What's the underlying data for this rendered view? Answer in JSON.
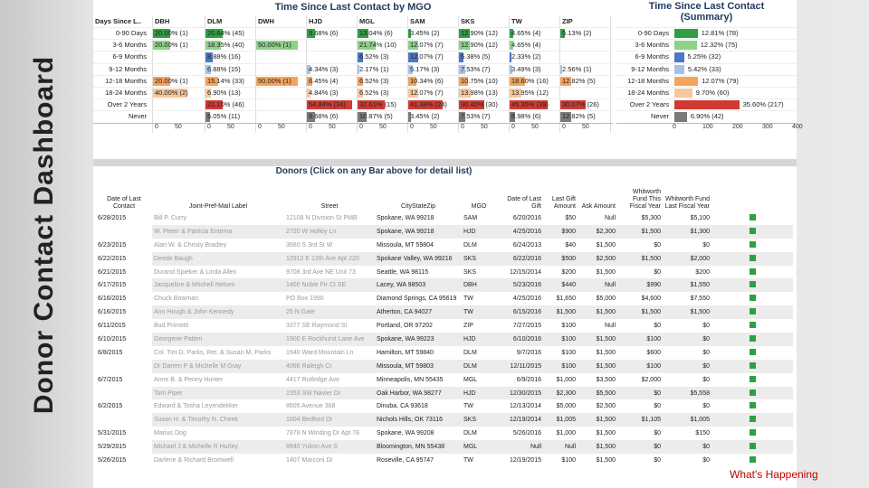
{
  "page_title": "Donor Contact Dashboard",
  "footer_note": "What's Happening",
  "chart_data": [
    {
      "type": "heatmap",
      "title": "Time Since Last Contact by MGO",
      "row_header": "Days Since L..",
      "columns": [
        "DBH",
        "DLM",
        "DWH",
        "HJD",
        "MGL",
        "SAM",
        "SKS",
        "TW",
        "ZIP"
      ],
      "rows": [
        "0-90 Days",
        "3-6 Months",
        "6-9 Months",
        "9-12 Months",
        "12-18 Months",
        "18-24 Months",
        "Over 2 Years",
        "Never"
      ],
      "row_colors": [
        "#2ea043",
        "#8fd18a",
        "#4a78c4",
        "#a9c0e6",
        "#f5a35b",
        "#f6c79b",
        "#d03a33",
        "#7a7a7a"
      ],
      "cells": [
        [
          "20.00% (1)",
          "20.64% (45)",
          "",
          "9.68% (6)",
          "13.04% (6)",
          "3.45% (2)",
          "12.90% (12)",
          "4.65% (4)",
          "5.13% (2)"
        ],
        [
          "20.00% (1)",
          "18.35% (40)",
          "50.00% (1)",
          "",
          "21.74% (10)",
          "12.07% (7)",
          "12.90% (12)",
          "4.65% (4)",
          ""
        ],
        [
          "",
          "8.88% (16)",
          "",
          "",
          "6.52% (3)",
          "12.07% (7)",
          "5.38% (5)",
          "2.33% (2)",
          ""
        ],
        [
          "",
          "6.88% (15)",
          "",
          "4.34% (3)",
          "2.17% (1)",
          "5.17% (3)",
          "7.53% (7)",
          "3.49% (3)",
          "2.56% (1)"
        ],
        [
          "20.00% (1)",
          "15.14% (33)",
          "50.00% (1)",
          "6.45% (4)",
          "6.52% (3)",
          "10.34% (6)",
          "10.75% (10)",
          "18.60% (16)",
          "12.82% (5)"
        ],
        [
          "40.00% (2)",
          "6.90% (13)",
          "",
          "4.84% (3)",
          "6.52% (3)",
          "12.07% (7)",
          "13.98% (13)",
          "13.95% (12)",
          ""
        ],
        [
          "",
          "21.10% (46)",
          "",
          "54.84% (34)",
          "32.61% (15)",
          "41.38% (24)",
          "30.40% (30)",
          "45.35% (39)",
          "30.07% (26)"
        ],
        [
          "",
          "5.05% (11)",
          "",
          "9.68% (6)",
          "10.87% (5)",
          "3.45% (2)",
          "7.53% (7)",
          "6.98% (6)",
          "12.82% (5)"
        ]
      ],
      "bar_values": [
        [
          20.0,
          20.64,
          0,
          9.68,
          13.04,
          3.45,
          12.9,
          4.65,
          5.13
        ],
        [
          20.0,
          18.35,
          50.0,
          0,
          21.74,
          12.07,
          12.9,
          4.65,
          0
        ],
        [
          0,
          8.88,
          0,
          0,
          6.52,
          12.07,
          5.38,
          2.33,
          0
        ],
        [
          0,
          6.88,
          0,
          4.34,
          2.17,
          5.17,
          7.53,
          3.49,
          2.56
        ],
        [
          20.0,
          15.14,
          50.0,
          6.45,
          6.52,
          10.34,
          10.75,
          18.6,
          12.82
        ],
        [
          40.0,
          6.9,
          0,
          4.84,
          6.52,
          12.07,
          13.98,
          13.95,
          0
        ],
        [
          0,
          21.1,
          0,
          54.84,
          32.61,
          41.38,
          30.4,
          45.35,
          30.07
        ],
        [
          0,
          5.05,
          0,
          9.68,
          10.87,
          3.45,
          7.53,
          6.98,
          12.82
        ]
      ],
      "axis_ticks": [
        "0",
        "50"
      ]
    },
    {
      "type": "bar",
      "title": "Time Since Last Contact (Summary)",
      "title_line1": "Time Since Last Contact",
      "title_line2": "(Summary)",
      "categories": [
        "0-90 Days",
        "3-6 Months",
        "6-9 Months",
        "9-12 Months",
        "12-18 Months",
        "18-24 Months",
        "Over 2 Years",
        "Never"
      ],
      "labels": [
        "12.81% (78)",
        "12.32% (75)",
        "5.25% (32)",
        "5.42% (33)",
        "12.07% (79)",
        "9.70% (60)",
        "35.60% (217)",
        "6.90% (42)"
      ],
      "values": [
        78,
        75,
        32,
        33,
        79,
        60,
        217,
        42
      ],
      "colors": [
        "#2ea043",
        "#8fd18a",
        "#4a78c4",
        "#a9c0e6",
        "#f5a35b",
        "#f6c79b",
        "#d03a33",
        "#7a7a7a"
      ],
      "axis_ticks": [
        "0",
        "100",
        "200",
        "300",
        "400"
      ],
      "xlim": [
        0,
        400
      ]
    }
  ],
  "donors": {
    "title": "Donors (Click on any Bar above for detail list)",
    "headers": [
      "Date of Last Contact",
      "Joint-Pref-Mail Label",
      "Street",
      "CityStateZip",
      "MGO",
      "Date of Last Gift",
      "Last Gift Amount",
      "Ask Amount",
      "Whitworth Fund This Fiscal Year",
      "Whitworth Fund Last Fiscal Year",
      ""
    ],
    "rows": [
      [
        "6/28/2015",
        "Bill P. Curry",
        "12108 N Division St PMB",
        "Spokane, WA 99218",
        "SAM",
        "6/20/2016",
        "$50",
        "Null",
        "$5,300",
        "$5,100"
      ],
      [
        "",
        "W. Pieter & Patricia Entema",
        "2720 W Holley Ln",
        "Spokane, WA 99218",
        "HJD",
        "4/25/2016",
        "$900",
        "$2,300",
        "$1,500",
        "$1,300"
      ],
      [
        "6/23/2015",
        "Alan W. & Christy Bradley",
        "3660 S 3rd St W",
        "Missoula, MT 59804",
        "DLM",
        "6/24/2013",
        "$40",
        "$1,500",
        "$0",
        "$0"
      ],
      [
        "6/22/2015",
        "Deede Baugh",
        "12912 E 12th Ave Apt 220",
        "Spokane Valley, WA 99216",
        "SKS",
        "6/22/2016",
        "$500",
        "$2,500",
        "$1,500",
        "$2,000"
      ],
      [
        "6/21/2015",
        "Durand Spieker & Linda Allen",
        "9708 3rd Ave NE Unit 73",
        "Seattle, WA 98115",
        "SKS",
        "12/15/2014",
        "$200",
        "$1,500",
        "$0",
        "$200"
      ],
      [
        "6/17/2015",
        "Jacqueline & Mitchell Nelsen",
        "1400 Noble Fir Ct SE",
        "Lacey, WA 98503",
        "DBH",
        "5/23/2016",
        "$440",
        "Null",
        "$990",
        "$1,550"
      ],
      [
        "6/16/2015",
        "Chuck Bowman",
        "PO Box 1990",
        "Diamond Springs, CA 95619",
        "TW",
        "4/25/2016",
        "$1,650",
        "$5,000",
        "$4,600",
        "$7,550"
      ],
      [
        "6/16/2015",
        "Ann Hough & John Kennedy",
        "25 N Gate",
        "Atherton, CA 94027",
        "TW",
        "6/15/2016",
        "$1,500",
        "$1,500",
        "$1,500",
        "$1,500"
      ],
      [
        "6/11/2015",
        "Bud Primotti",
        "3377 SE Raymond St",
        "Portland, OR 97202",
        "ZIP",
        "7/27/2015",
        "$100",
        "Null",
        "$0",
        "$0"
      ],
      [
        "6/10/2015",
        "Georgene Patten",
        "1900 E Rockhurst Lane Ave",
        "Spokane, WA 99223",
        "HJD",
        "6/10/2016",
        "$100",
        "$1,500",
        "$100",
        "$0"
      ],
      [
        "6/8/2015",
        "Col. Tim D. Parks, Ret. & Susan M. Parks",
        "1940 Ward Mountain Ln",
        "Hamilton, MT 59840",
        "DLM",
        "9/7/2016",
        "$100",
        "$1,500",
        "$600",
        "$0"
      ],
      [
        "",
        "Dr Darren P & Michelle M Gray",
        "4066 Raleigh Ct",
        "Missoula, MT 59803",
        "DLM",
        "12/11/2015",
        "$100",
        "$1,500",
        "$100",
        "$0"
      ],
      [
        "6/7/2015",
        "Anne B. & Penny Hunter",
        "4417 Rutledge Ave",
        "Minneapolis, MN 55435",
        "MGL",
        "6/9/2016",
        "$1,000",
        "$3,500",
        "$2,000",
        "$0"
      ],
      [
        "",
        "Tom Piper",
        "1553 SW Navier Dr",
        "Oak Harbor, WA 98277",
        "HJD",
        "12/30/2015",
        "$2,300",
        "$5,500",
        "$0",
        "$5,558"
      ],
      [
        "6/2/2015",
        "Edward & Tosha Leyendekker",
        "8605 Avenue 368",
        "Dinuba, CA 93618",
        "TW",
        "12/13/2014",
        "$5,000",
        "$2,500",
        "$0",
        "$0"
      ],
      [
        "",
        "Susan H. & Timothy N. Cheek",
        "1604 Bedford Dr",
        "Nichols Hills, OK 73116",
        "SKS",
        "12/19/2014",
        "$1,005",
        "$1,500",
        "$1,105",
        "$1,005"
      ],
      [
        "5/31/2015",
        "Marius Dog",
        "7878 N Winding Dr Apt 78",
        "Spokane, WA 99208",
        "DLM",
        "5/26/2016",
        "$1,000",
        "$1,500",
        "$0",
        "$150"
      ],
      [
        "5/29/2015",
        "Michael J & Michelle R Hurley",
        "9940 Yukon Ave S",
        "Bloomington, MN 55438",
        "MGL",
        "Null",
        "Null",
        "$1,500",
        "$0",
        "$0"
      ],
      [
        "5/26/2015",
        "Darlene & Richard Bromwell",
        "1407 Marconi Dr",
        "Roseville, CA 95747",
        "TW",
        "12/19/2015",
        "$100",
        "$1,500",
        "$0",
        "$0"
      ]
    ]
  }
}
